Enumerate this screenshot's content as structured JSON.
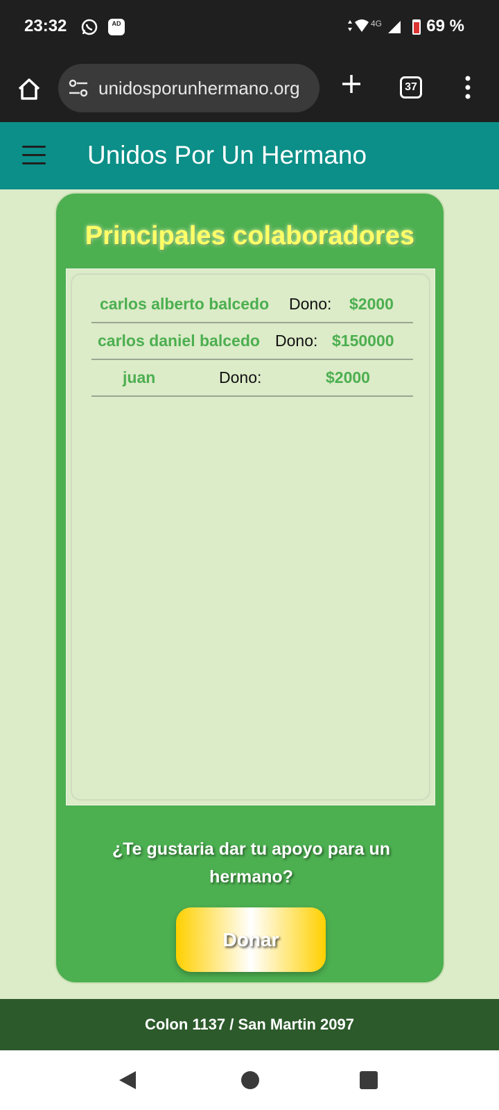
{
  "status_bar": {
    "time": "23:32",
    "ad_badge": "AD",
    "network": "4G",
    "battery": "69 %"
  },
  "browser": {
    "url": "unidosporunhermano.org",
    "tab_count": "37"
  },
  "header": {
    "title": "Unidos Por Un Hermano"
  },
  "card": {
    "title": "Principales colaboradores",
    "donations": [
      {
        "name": "carlos alberto balcedo",
        "verb": "Dono:",
        "amount": "$2000"
      },
      {
        "name": "carlos daniel balcedo",
        "verb": "Dono:",
        "amount": "$150000"
      },
      {
        "name": "juan",
        "verb": "Dono:",
        "amount": "$2000"
      }
    ],
    "question": "¿Te gustaria dar tu apoyo para un hermano?",
    "donate_label": "Donar"
  },
  "footer": {
    "address": "Colon 1137 / San Martin 2097"
  },
  "colors": {
    "header_bg": "#0b8f88",
    "card_bg": "#4caf50",
    "page_bg": "#dcebc8",
    "footer_bg": "#2c5a2b",
    "title_yellow": "#ffff66",
    "donate_gold": "#ffd000"
  }
}
